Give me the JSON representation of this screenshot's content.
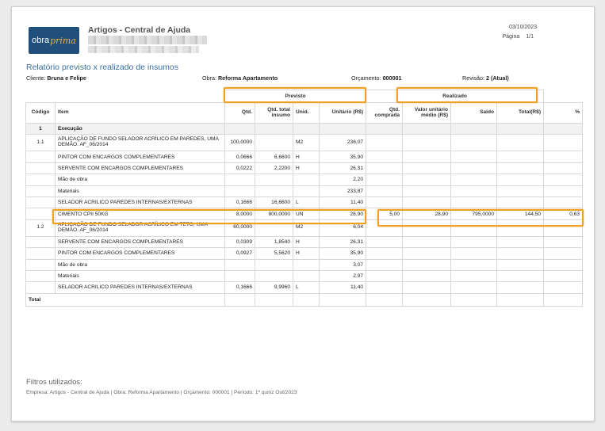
{
  "header": {
    "logo": {
      "part1": "obra",
      "part2": "prima"
    },
    "app_title": "Artigos - Central de Ajuda",
    "date": "03/10/2023",
    "page_label": "Página",
    "page_value": "1/1"
  },
  "report": {
    "title": "Relatório previsto x realizado de insumos",
    "cliente_label": "Cliente:",
    "cliente_value": "Bruna e Felipe",
    "obra_label": "Obra:",
    "obra_value": "Reforma Apartamento",
    "orcamento_label": "Orçamento:",
    "orcamento_value": "000001",
    "revisao_label": "Revisão:",
    "revisao_value": "2 (Atual)"
  },
  "table": {
    "group_previsto": "Previsto",
    "group_realizado": "Realizado",
    "headers": {
      "codigo": "Código",
      "item": "Item",
      "qtd": "Qtd.",
      "qtd_total": "Qtd. total insumo",
      "unid": "Unid.",
      "unitario": "Unitário (R$)",
      "qtd_comprada": "Qtd. comprada",
      "valor_unitario_medio": "Valor unitário médio (R$)",
      "saldo": "Saldo",
      "total": "Total(R$)",
      "pct": "%"
    },
    "section": {
      "code": "1",
      "label": "Execução"
    },
    "rows": [
      {
        "code": "1.1",
        "item": "APLICAÇÃO DE FUNDO SELADOR ACRÍLICO EM PAREDES, UMA DEMÃO. AF_06/2014",
        "qtd": "100,0000",
        "qtd_total": "",
        "unid": "M2",
        "unit": "236,07",
        "qtd_comp": "",
        "vum": "",
        "saldo": "",
        "total": "",
        "pct": "",
        "tall": true
      },
      {
        "code": "",
        "item": "PINTOR COM ENCARGOS COMPLEMENTARES",
        "qtd": "0,0666",
        "qtd_total": "6,6600",
        "unid": "H",
        "unit": "35,90",
        "qtd_comp": "",
        "vum": "",
        "saldo": "",
        "total": "",
        "pct": ""
      },
      {
        "code": "",
        "item": "SERVENTE COM ENCARGOS COMPLEMENTARES",
        "qtd": "0,0222",
        "qtd_total": "2,2200",
        "unid": "H",
        "unit": "26,31",
        "qtd_comp": "",
        "vum": "",
        "saldo": "",
        "total": "",
        "pct": ""
      },
      {
        "code": "",
        "item": "Mão de obra",
        "qtd": "",
        "qtd_total": "",
        "unid": "",
        "unit": "2,20",
        "qtd_comp": "",
        "vum": "",
        "saldo": "",
        "total": "",
        "pct": "",
        "sub": true
      },
      {
        "code": "",
        "item": "Materiais",
        "qtd": "",
        "qtd_total": "",
        "unid": "",
        "unit": "233,87",
        "qtd_comp": "",
        "vum": "",
        "saldo": "",
        "total": "",
        "pct": "",
        "sub": true
      },
      {
        "code": "",
        "item": "SELADOR ACRILICO PAREDES INTERNAS/EXTERNAS",
        "qtd": "0,1666",
        "qtd_total": "16,6600",
        "unid": "L",
        "unit": "11,40",
        "qtd_comp": "",
        "vum": "",
        "saldo": "",
        "total": "",
        "pct": ""
      },
      {
        "code": "",
        "item": "CIMENTO CPII 50KG",
        "qtd": "8,0000",
        "qtd_total": "800,0000",
        "unid": "UN",
        "unit": "28,90",
        "qtd_comp": "5,00",
        "vum": "28,90",
        "saldo": "795,0000",
        "total": "144,50",
        "pct": "0,63"
      },
      {
        "code": "1.2",
        "item": "APLICAÇÃO DE FUNDO SELADOR ACRÍLICO EM TETO, UMA DEMÃO. AF_06/2014",
        "qtd": "60,0000",
        "qtd_total": "",
        "unid": "M2",
        "unit": "6,04",
        "qtd_comp": "",
        "vum": "",
        "saldo": "",
        "total": "",
        "pct": "",
        "tall": true
      },
      {
        "code": "",
        "item": "SERVENTE COM ENCARGOS COMPLEMENTARES",
        "qtd": "0,0309",
        "qtd_total": "1,8540",
        "unid": "H",
        "unit": "26,31",
        "qtd_comp": "",
        "vum": "",
        "saldo": "",
        "total": "",
        "pct": ""
      },
      {
        "code": "",
        "item": "PINTOR COM ENCARGOS COMPLEMENTARES",
        "qtd": "0,0927",
        "qtd_total": "5,5620",
        "unid": "H",
        "unit": "35,90",
        "qtd_comp": "",
        "vum": "",
        "saldo": "",
        "total": "",
        "pct": ""
      },
      {
        "code": "",
        "item": "Mão de obra",
        "qtd": "",
        "qtd_total": "",
        "unid": "",
        "unit": "3,07",
        "qtd_comp": "",
        "vum": "",
        "saldo": "",
        "total": "",
        "pct": "",
        "sub": true
      },
      {
        "code": "",
        "item": "Materiais",
        "qtd": "",
        "qtd_total": "",
        "unid": "",
        "unit": "2,97",
        "qtd_comp": "",
        "vum": "",
        "saldo": "",
        "total": "",
        "pct": "",
        "sub": true
      },
      {
        "code": "",
        "item": "SELADOR ACRILICO PAREDES INTERNAS/EXTERNAS",
        "qtd": "0,1666",
        "qtd_total": "9,9960",
        "unid": "L",
        "unit": "11,40",
        "qtd_comp": "",
        "vum": "",
        "saldo": "",
        "total": "",
        "pct": ""
      }
    ],
    "total_label": "Total"
  },
  "filters": {
    "title": "Filtros utilizados:",
    "text": "Empresa: Artigos - Central de Ajuda | Obra: Reforma Apartamento | Orçamento: 000001 | Período: 1ª quinz Out/2023"
  },
  "colors": {
    "highlight": "#f0a121",
    "title_blue": "#3b6fa0",
    "logo_bg": "#1f4f7a"
  }
}
